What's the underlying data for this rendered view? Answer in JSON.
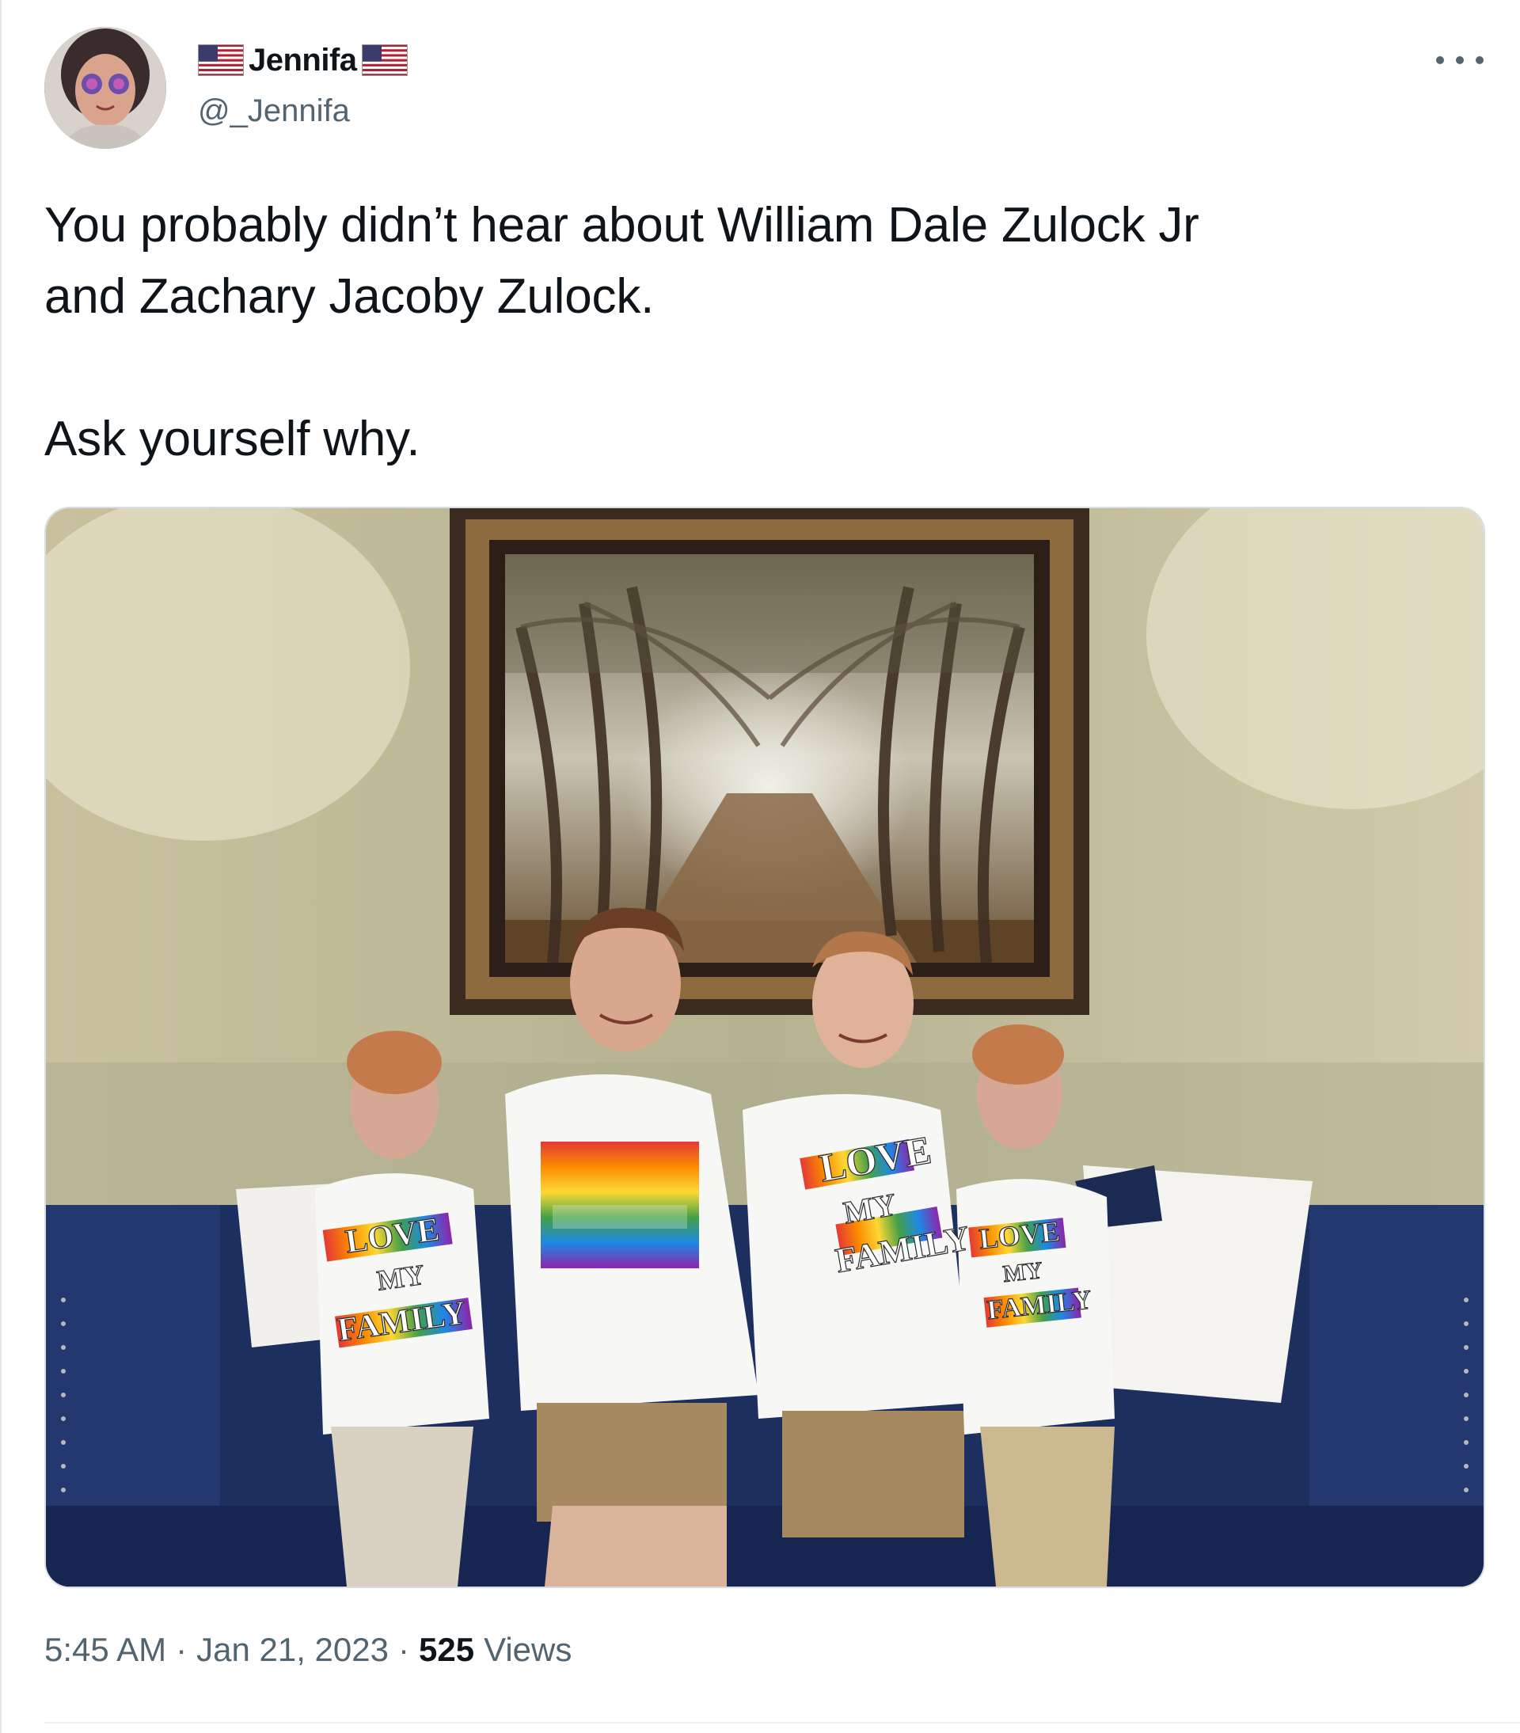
{
  "author": {
    "display_name": "Jennifa",
    "handle": "@_Jennifa",
    "name_decorations": [
      "us-flag-icon",
      "us-flag-icon"
    ]
  },
  "tweet": {
    "text": "You probably didn’t hear about William Dale Zulock Jr\nand Zachary Jacoby Zulock.\n\nAsk yourself why."
  },
  "photo": {
    "shirt_text_left": [
      "LOVE",
      "MY",
      "FAMILY"
    ],
    "shirt_text_right": [
      "LOVE",
      "MY",
      "FAMILY"
    ],
    "shirt_text_small": [
      "LOVE",
      "MY",
      "FAMILY"
    ]
  },
  "meta": {
    "time": "5:45 AM",
    "separator": "·",
    "date": "Jan 21, 2023",
    "views_count": "525",
    "views_label": "Views"
  },
  "colors": {
    "text_primary": "#0f1419",
    "text_secondary": "#536471",
    "sofa": "#1f3468",
    "wall": "#b9b48f"
  }
}
